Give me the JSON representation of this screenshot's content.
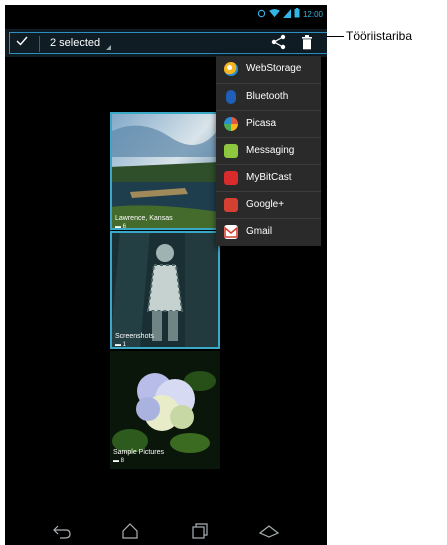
{
  "status_bar": {
    "time": "12:00"
  },
  "action_bar": {
    "selected_label": "2 selected"
  },
  "share_menu": {
    "items": [
      {
        "label": "WebStorage",
        "icon": "webstorage-icon",
        "color": "#f7b51d"
      },
      {
        "label": "Bluetooth",
        "icon": "bluetooth-icon",
        "color": "#1f5fb8"
      },
      {
        "label": "Picasa",
        "icon": "picasa-icon",
        "color": "#e2583e"
      },
      {
        "label": "Messaging",
        "icon": "messaging-icon",
        "color": "#8dc63f"
      },
      {
        "label": "MyBitCast",
        "icon": "mybitcast-icon",
        "color": "#d92b2b"
      },
      {
        "label": "Google+",
        "icon": "google-plus-icon",
        "color": "#d44132"
      },
      {
        "label": "Gmail",
        "icon": "gmail-icon",
        "color": "#ffffff"
      }
    ]
  },
  "albums": [
    {
      "name": "Lawrence, Kansas",
      "count": "6"
    },
    {
      "name": "Screenshots",
      "count": "1"
    },
    {
      "name": "Sample Pictures",
      "count": "8"
    }
  ],
  "callout": {
    "text": "Tööriistariba"
  },
  "colors": {
    "accent": "#33b5e5",
    "selection": "#39a9c7",
    "menu_bg": "#2a2a2a"
  }
}
